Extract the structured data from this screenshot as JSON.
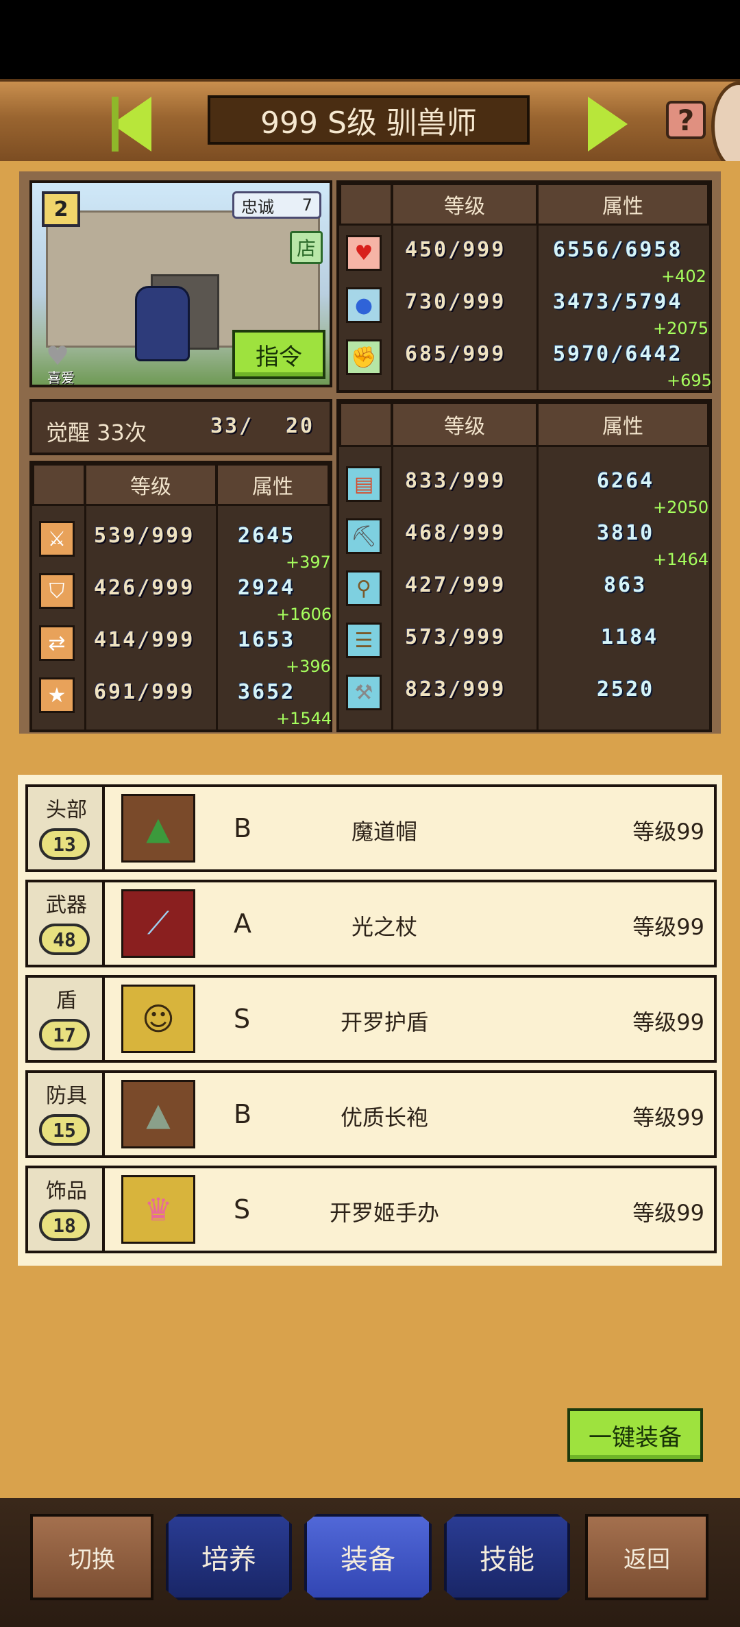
{
  "header": {
    "title": "999 S级 驯兽师",
    "help_label": "?"
  },
  "portrait": {
    "rank": "2",
    "loyalty_label": "忠诚",
    "loyalty_value": "7",
    "shop_label": "店",
    "command_label": "指令",
    "favorite_label": "喜爱"
  },
  "awaken": {
    "label": "觉醒 33次",
    "current": "33/",
    "max": "20"
  },
  "top_table": {
    "col_level": "等级",
    "col_attr": "属性",
    "rows": [
      {
        "icon": "heart-icon",
        "level": "450/999",
        "attr": "6556/6958",
        "bonus": "+402"
      },
      {
        "icon": "mana-potion-icon",
        "level": "730/999",
        "attr": "3473/5794",
        "bonus": "+2075"
      },
      {
        "icon": "stamina-arm-icon",
        "level": "685/999",
        "attr": "5970/6442",
        "bonus": "+695"
      }
    ]
  },
  "left_table": {
    "col_level": "等级",
    "col_attr": "属性",
    "rows": [
      {
        "icon": "sword-icon",
        "level": "539/999",
        "attr": "2645",
        "bonus": "+397"
      },
      {
        "icon": "shield-icon",
        "level": "426/999",
        "attr": "2924",
        "bonus": "+1606"
      },
      {
        "icon": "crossed-arrows-icon",
        "level": "414/999",
        "attr": "1653",
        "bonus": "+396"
      },
      {
        "icon": "star-icon",
        "level": "691/999",
        "attr": "3652",
        "bonus": "+1544"
      }
    ]
  },
  "right_table": {
    "col_level": "等级",
    "col_attr": "属性",
    "rows": [
      {
        "icon": "book-icon",
        "level": "833/999",
        "attr": "6264",
        "bonus": "+2050"
      },
      {
        "icon": "pickaxe-icon",
        "level": "468/999",
        "attr": "3810",
        "bonus": "+1464"
      },
      {
        "icon": "shovel-icon",
        "level": "427/999",
        "attr": "863",
        "bonus": ""
      },
      {
        "icon": "anvil-icon",
        "level": "573/999",
        "attr": "1184",
        "bonus": ""
      },
      {
        "icon": "hammer-icon",
        "level": "823/999",
        "attr": "2520",
        "bonus": ""
      }
    ]
  },
  "equipment": [
    {
      "slot": "头部",
      "slot_level": "13",
      "icon": "wizard-hat-icon",
      "grade": "B",
      "name": "魔道帽",
      "level": "等级99",
      "bg": "#7a4a2a"
    },
    {
      "slot": "武器",
      "slot_level": "48",
      "icon": "staff-icon",
      "grade": "A",
      "name": "光之杖",
      "level": "等级99",
      "bg": "#8a1f1f"
    },
    {
      "slot": "盾",
      "slot_level": "17",
      "icon": "kairo-shield-icon",
      "grade": "S",
      "name": "开罗护盾",
      "level": "等级99",
      "bg": "#d8b43c"
    },
    {
      "slot": "防具",
      "slot_level": "15",
      "icon": "robe-icon",
      "grade": "B",
      "name": "优质长袍",
      "level": "等级99",
      "bg": "#7a4a2a"
    },
    {
      "slot": "饰品",
      "slot_level": "18",
      "icon": "kairo-figure-icon",
      "grade": "S",
      "name": "开罗姬手办",
      "level": "等级99",
      "bg": "#d8b43c"
    }
  ],
  "one_click_equip": "一键装备",
  "nav": {
    "switch": "切换",
    "train": "培养",
    "equip": "装备",
    "skill": "技能",
    "back": "返回"
  },
  "colors": {
    "accent_green": "#9ee23e",
    "bonus_green": "#a6ff5e",
    "panel_dark": "#3e2f24",
    "background": "#d9a24c",
    "nav_blue": "#2a3c93"
  }
}
